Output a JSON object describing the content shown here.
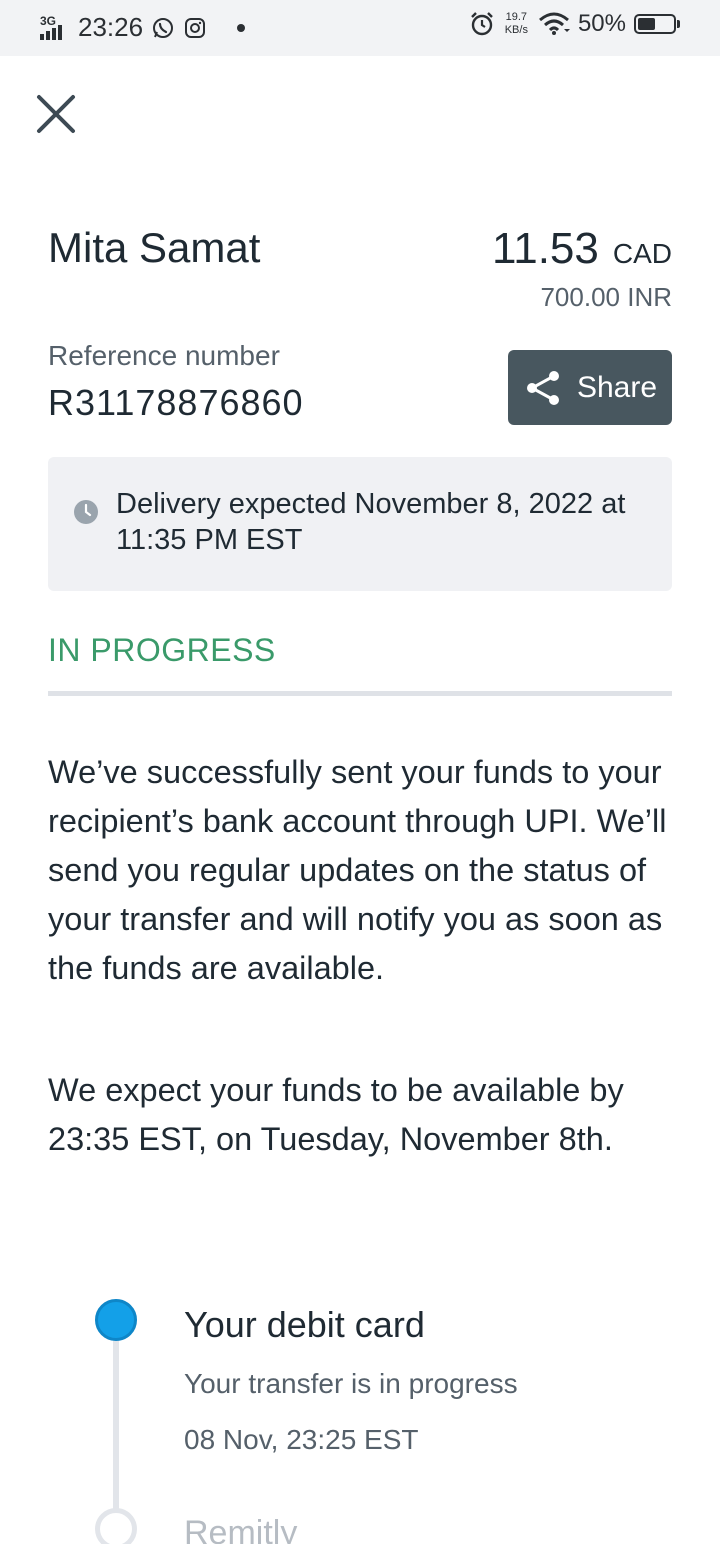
{
  "status_bar": {
    "network": "3G",
    "time": "23:26",
    "speed_value": "19.7",
    "speed_unit": "KB/s",
    "battery": "50%",
    "battery_level": 0.5,
    "icons": [
      "signal-icon",
      "whatsapp-icon",
      "instagram-icon",
      "notification-dot-icon",
      "alarm-icon",
      "wifi-icon",
      "battery-icon"
    ]
  },
  "header": {
    "close_icon": "close-icon"
  },
  "transfer": {
    "recipient_name": "Mita Samat",
    "amount": "11.53",
    "currency": "CAD",
    "received_amount": "700.00 INR",
    "reference_label": "Reference number",
    "reference_number": "R31178876860",
    "share_label": "Share"
  },
  "delivery": {
    "text": "Delivery expected November 8, 2022 at 11:35 PM EST"
  },
  "status": {
    "label": "IN PROGRESS",
    "color": "#3a9a6a"
  },
  "messages": {
    "paragraph1": "We’ve successfully sent your funds to your recipient’s bank account through UPI. We’ll send you regular updates on the status of your transfer and will notify you as soon as the funds are available.",
    "paragraph2": "We expect your funds to be available by 23:35 EST, on Tuesday, November 8th."
  },
  "timeline": [
    {
      "title": "Your debit card",
      "subtitle": "Your transfer is in progress",
      "time": "08 Nov, 23:25 EST",
      "state": "active"
    },
    {
      "title": "Remitly",
      "state": "pending"
    }
  ],
  "colors": {
    "accent": "#13a0e8",
    "share_button": "#48575f",
    "status_green": "#3a9a6a"
  }
}
